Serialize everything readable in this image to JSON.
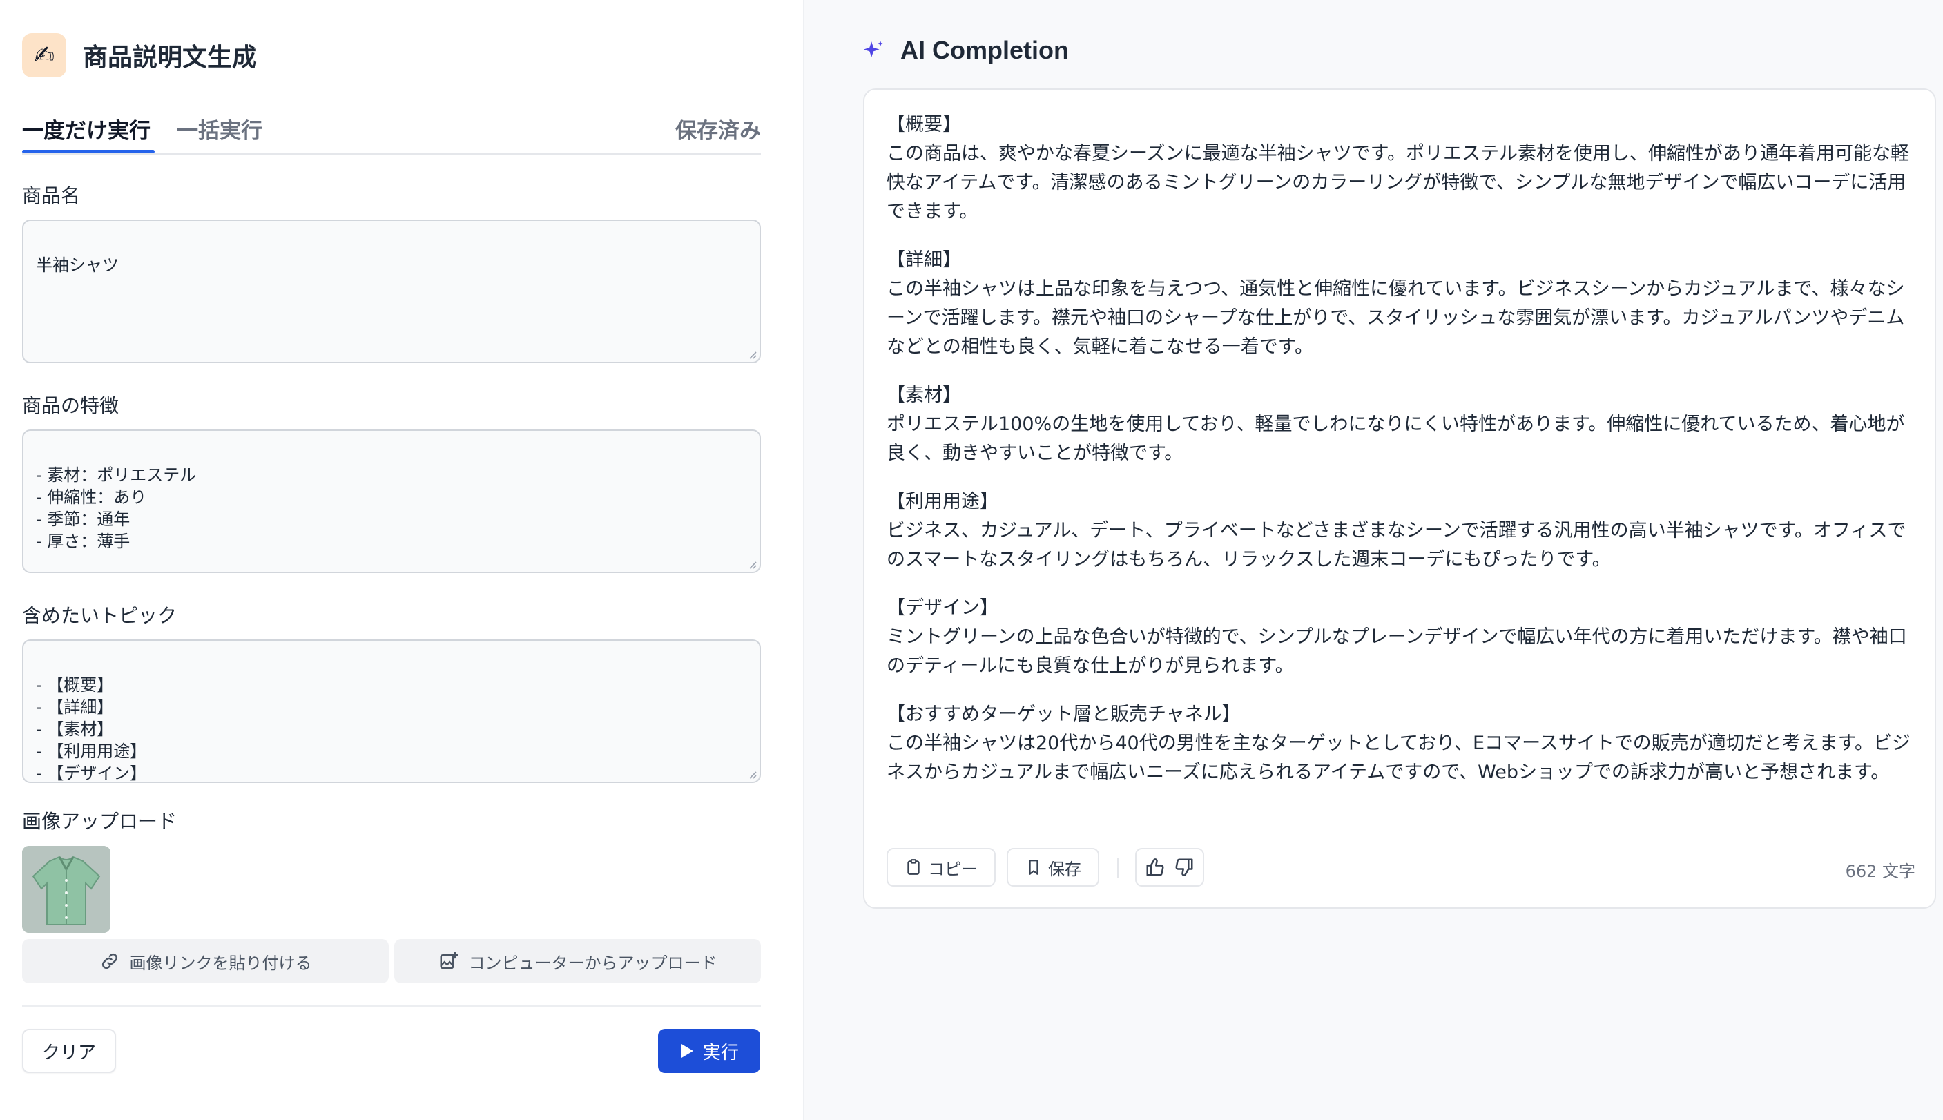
{
  "header": {
    "icon": "✍",
    "title": "商品説明文生成"
  },
  "tabs": {
    "once": "一度だけ実行",
    "batch": "一括実行",
    "saved": "保存済み"
  },
  "form": {
    "product_name": {
      "label": "商品名",
      "value": "半袖シャツ"
    },
    "features": {
      "label": "商品の特徴",
      "value": "- 素材：ポリエステル\n- 伸縮性：あり\n- 季節：通年\n- 厚さ：薄手"
    },
    "topics": {
      "label": "含めたいトピック",
      "value": "- 【概要】\n- 【詳細】\n- 【素材】\n- 【利用用途】\n- 【デザイン】"
    },
    "image_upload": {
      "label": "画像アップロード",
      "paste_link": "画像リンクを貼り付ける",
      "upload_computer": "コンピューターからアップロード"
    }
  },
  "buttons": {
    "clear": "クリア",
    "run": "実行"
  },
  "completion": {
    "title": "AI Completion",
    "sections": [
      {
        "heading": "【概要】",
        "body": "この商品は、爽やかな春夏シーズンに最適な半袖シャツです。ポリエステル素材を使用し、伸縮性があり通年着用可能な軽快なアイテムです。清潔感のあるミントグリーンのカラーリングが特徴で、シンプルな無地デザインで幅広いコーデに活用できます。"
      },
      {
        "heading": "【詳細】",
        "body": "この半袖シャツは上品な印象を与えつつ、通気性と伸縮性に優れています。ビジネスシーンからカジュアルまで、様々なシーンで活躍します。襟元や袖口のシャープな仕上がりで、スタイリッシュな雰囲気が漂います。カジュアルパンツやデニムなどとの相性も良く、気軽に着こなせる一着です。"
      },
      {
        "heading": "【素材】",
        "body": "ポリエステル100%の生地を使用しており、軽量でしわになりにくい特性があります。伸縮性に優れているため、着心地が良く、動きやすいことが特徴です。"
      },
      {
        "heading": "【利用用途】",
        "body": "ビジネス、カジュアル、デート、プライベートなどさまざまなシーンで活躍する汎用性の高い半袖シャツです。オフィスでのスマートなスタイリングはもちろん、リラックスした週末コーデにもぴったりです。"
      },
      {
        "heading": "【デザイン】",
        "body": "ミントグリーンの上品な色合いが特徴的で、シンプルなプレーンデザインで幅広い年代の方に着用いただけます。襟や袖口のデティールにも良質な仕上がりが見られます。"
      },
      {
        "heading": "【おすすめターゲット層と販売チャネル】",
        "body": "この半袖シャツは20代から40代の男性を主なターゲットとしており、Eコマースサイトでの販売が適切だと考えます。ビジネスからカジュアルまで幅広いニーズに応えられるアイテムですので、Webショップでの訴求力が高いと予想されます。"
      }
    ],
    "copy_label": "コピー",
    "save_label": "保存",
    "char_count": "662 文字"
  },
  "colors": {
    "accent": "#1d4ed8",
    "shirt": "#8fc2a4",
    "sparkle": "#4f46e5"
  },
  "icons": [
    "writing-hand-icon",
    "sparkle-icon",
    "link-icon",
    "image-plus-icon",
    "play-icon",
    "clipboard-icon",
    "bookmark-icon",
    "thumbs-up-icon",
    "thumbs-down-icon"
  ]
}
